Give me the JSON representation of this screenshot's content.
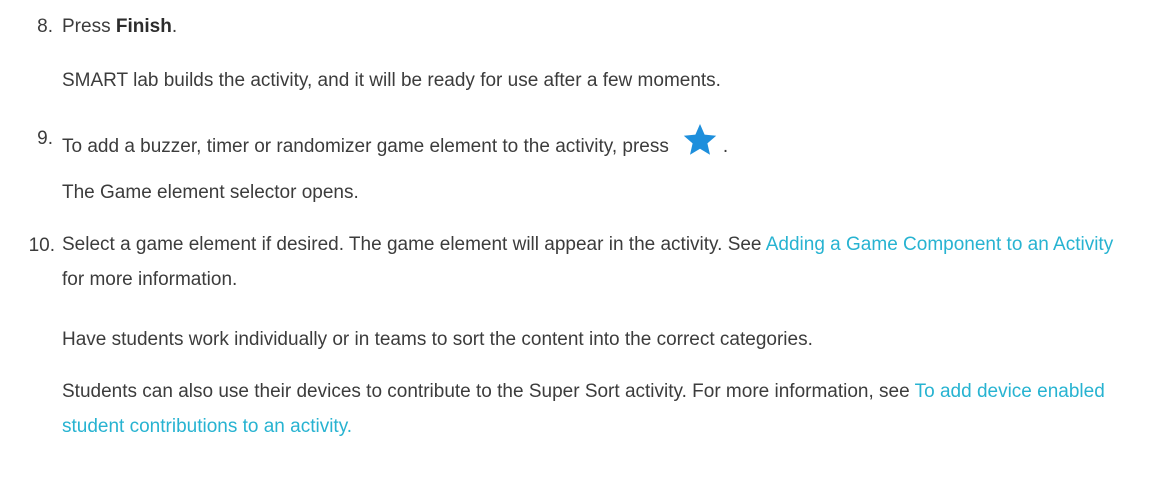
{
  "steps": [
    {
      "number": "8.",
      "text_before": "Press ",
      "bold": "Finish",
      "text_after": ".",
      "result": "SMART lab builds the activity, and it will be ready for use after a few moments."
    },
    {
      "number": "9.",
      "text_before": "To add a buzzer, timer or randomizer game element to the activity, press",
      "icon": "star-icon",
      "icon_color": "#1e8fdc",
      "text_after": ".",
      "result": "The Game element selector opens."
    },
    {
      "number": "10.",
      "text_before": "Select a game element if desired. The game element will appear in the activity. See ",
      "link": "Adding a Game Component to an Activity",
      "text_after": " for more information.",
      "result_1": "Have students work individually or in teams to sort the content into the correct categories.",
      "result_2_before": "Students can also use their devices to contribute to the Super Sort activity. For more information, see ",
      "result_2_link": "To add device enabled student contributions to an activity."
    }
  ],
  "colors": {
    "text": "#3c3c3c",
    "link": "#27b3d1",
    "icon": "#1e8fdc"
  }
}
